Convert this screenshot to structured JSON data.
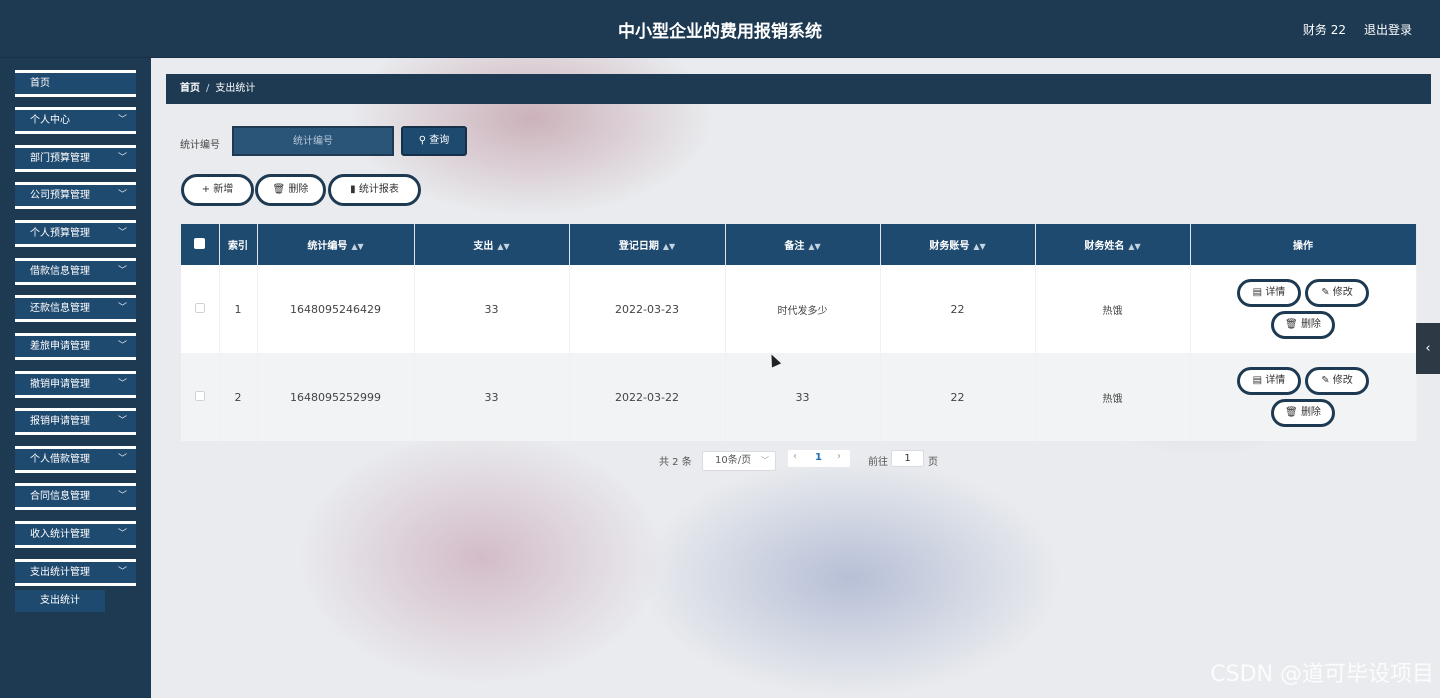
{
  "header": {
    "title": "中小型企业的费用报销系统",
    "user": "财务 22",
    "logout": "退出登录"
  },
  "sidebar": {
    "items": [
      {
        "label": "首页"
      },
      {
        "label": "个人中心"
      },
      {
        "label": "部门预算管理"
      },
      {
        "label": "公司预算管理"
      },
      {
        "label": "个人预算管理"
      },
      {
        "label": "借款信息管理"
      },
      {
        "label": "还款信息管理"
      },
      {
        "label": "差旅申请管理"
      },
      {
        "label": "撤销申请管理"
      },
      {
        "label": "报销申请管理"
      },
      {
        "label": "个人借款管理"
      },
      {
        "label": "合同信息管理"
      },
      {
        "label": "收入统计管理"
      },
      {
        "label": "支出统计管理"
      }
    ],
    "sub_item": "支出统计"
  },
  "breadcrumb": {
    "home": "首页",
    "sep": "/",
    "current": "支出统计"
  },
  "search": {
    "label": "统计编号",
    "placeholder": "统计编号",
    "button": "查询"
  },
  "actions": {
    "add": "新增",
    "delete": "删除",
    "report": "统计报表"
  },
  "table": {
    "headers": [
      "索引",
      "统计编号",
      "支出",
      "登记日期",
      "备注",
      "财务账号",
      "财务姓名",
      "操作"
    ],
    "rows": [
      {
        "index": "1",
        "code": "1648095246429",
        "expense": "33",
        "date": "2022-03-23",
        "remark": "时代发多少",
        "account": "22",
        "name": "热饿"
      },
      {
        "index": "2",
        "code": "1648095252999",
        "expense": "33",
        "date": "2022-03-22",
        "remark": "33",
        "account": "22",
        "name": "热饿"
      }
    ],
    "op_labels": {
      "detail": "详情",
      "edit": "修改",
      "delete": "删除"
    }
  },
  "pagination": {
    "total": "共 2 条",
    "page_size": "10条/页",
    "current": "1",
    "goto_label": "前往",
    "goto_value": "1",
    "goto_unit": "页"
  },
  "watermark": "CSDN @道可毕设项目"
}
